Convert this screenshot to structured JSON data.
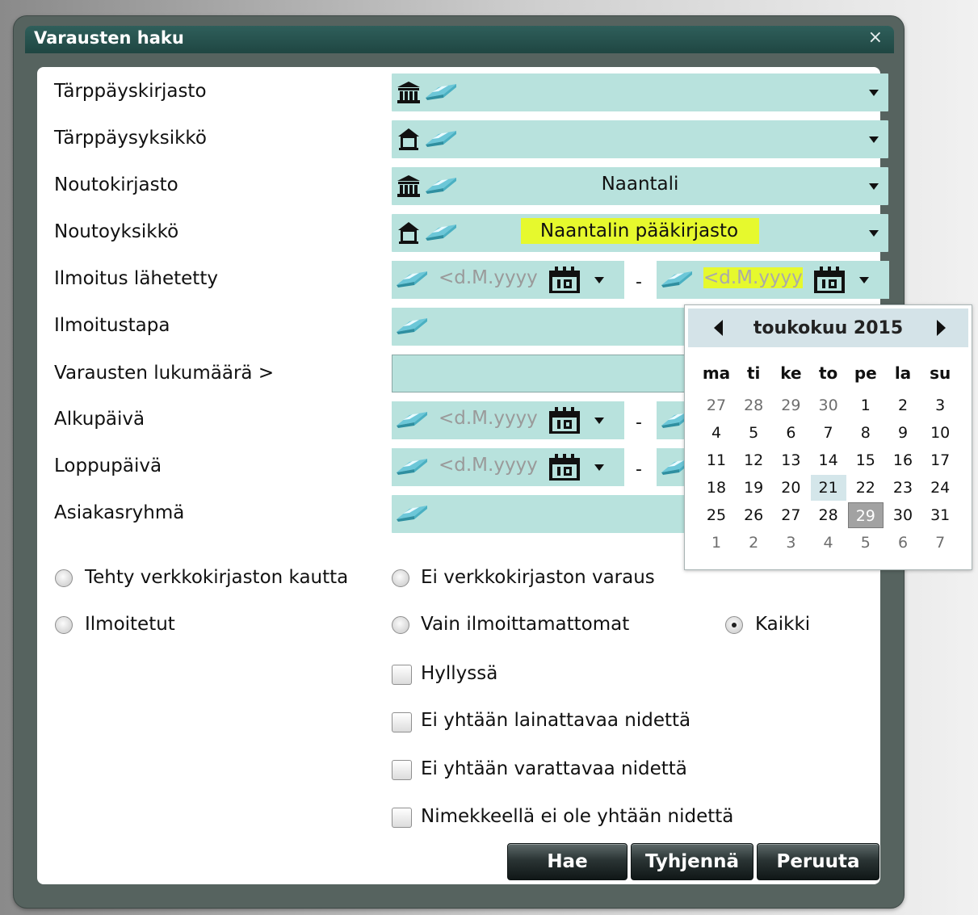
{
  "dialog": {
    "title": "Varausten haku",
    "close_glyph": "×"
  },
  "rows": {
    "tarppays_kirjasto": {
      "label": "Tärppäyskirjasto",
      "value": ""
    },
    "tarppays_yksikko": {
      "label": "Tärppäysyksikkö",
      "value": ""
    },
    "noutokirjasto": {
      "label": "Noutokirjasto",
      "value": "Naantali"
    },
    "noutoyksikko": {
      "label": "Noutoyksikkö",
      "value": "Naantalin pääkirjasto"
    },
    "ilmoitus_lahetetty": {
      "label": "Ilmoitus lähetetty",
      "from_placeholder": "<d.M.yyyy",
      "to_placeholder": "<d.M.yyyy"
    },
    "ilmoitustapa": {
      "label": "Ilmoitustapa"
    },
    "varausten_lukumaara": {
      "label": "Varausten lukumäärä >",
      "value": ""
    },
    "alkupaiva": {
      "label": "Alkupäivä",
      "from_placeholder": "<d.M.yyyy"
    },
    "loppupaiva": {
      "label": "Loppupäivä",
      "from_placeholder": "<d.M.yyyy"
    },
    "asiakasryhma": {
      "label": "Asiakasryhmä"
    }
  },
  "range_separator": "-",
  "radio_options": {
    "tehty_verkkokirjaston_kautta": {
      "label": "Tehty verkkokirjaston kautta",
      "checked": false
    },
    "ei_verkkokirjaston_varaus": {
      "label": "Ei verkkokirjaston varaus",
      "checked": false
    },
    "ilmoitetut": {
      "label": "Ilmoitetut",
      "checked": false
    },
    "vain_ilmoittamattomat": {
      "label": "Vain ilmoittamattomat",
      "checked": false
    },
    "kaikki": {
      "label": "Kaikki",
      "checked": true
    }
  },
  "checkboxes": {
    "hyllyssa": {
      "label": "Hyllyssä",
      "checked": false
    },
    "ei_lainattavaa": {
      "label": "Ei yhtään lainattavaa nidettä",
      "checked": false
    },
    "ei_varattavaa": {
      "label": "Ei yhtään varattavaa nidettä",
      "checked": false
    },
    "nimekkeella_ei_nidetta": {
      "label": "Nimekkeellä ei ole yhtään nidettä",
      "checked": false
    }
  },
  "buttons": {
    "search": "Hae",
    "clear": "Tyhjennä",
    "cancel": "Peruuta"
  },
  "calendar": {
    "month_label": "toukokuu 2015",
    "weekdays": [
      "ma",
      "ti",
      "ke",
      "to",
      "pe",
      "la",
      "su"
    ],
    "weeks": [
      [
        "27",
        "28",
        "29",
        "30",
        "1",
        "2",
        "3"
      ],
      [
        "4",
        "5",
        "6",
        "7",
        "8",
        "9",
        "10"
      ],
      [
        "11",
        "12",
        "13",
        "14",
        "15",
        "16",
        "17"
      ],
      [
        "18",
        "19",
        "20",
        "21",
        "22",
        "23",
        "24"
      ],
      [
        "25",
        "26",
        "27",
        "28",
        "29",
        "30",
        "31"
      ],
      [
        "1",
        "2",
        "3",
        "4",
        "5",
        "6",
        "7"
      ]
    ],
    "today": "21",
    "selected": "29"
  },
  "colors": {
    "field_bg": "#b8e2dd",
    "highlight": "#e6f92d",
    "titlebar": "#1f4642"
  },
  "icons": {
    "library": "library-building-icon",
    "unit": "house-icon",
    "eraser": "eraser-icon",
    "calendar": "calendar-icon",
    "dropdown": "dropdown-arrow-icon"
  }
}
